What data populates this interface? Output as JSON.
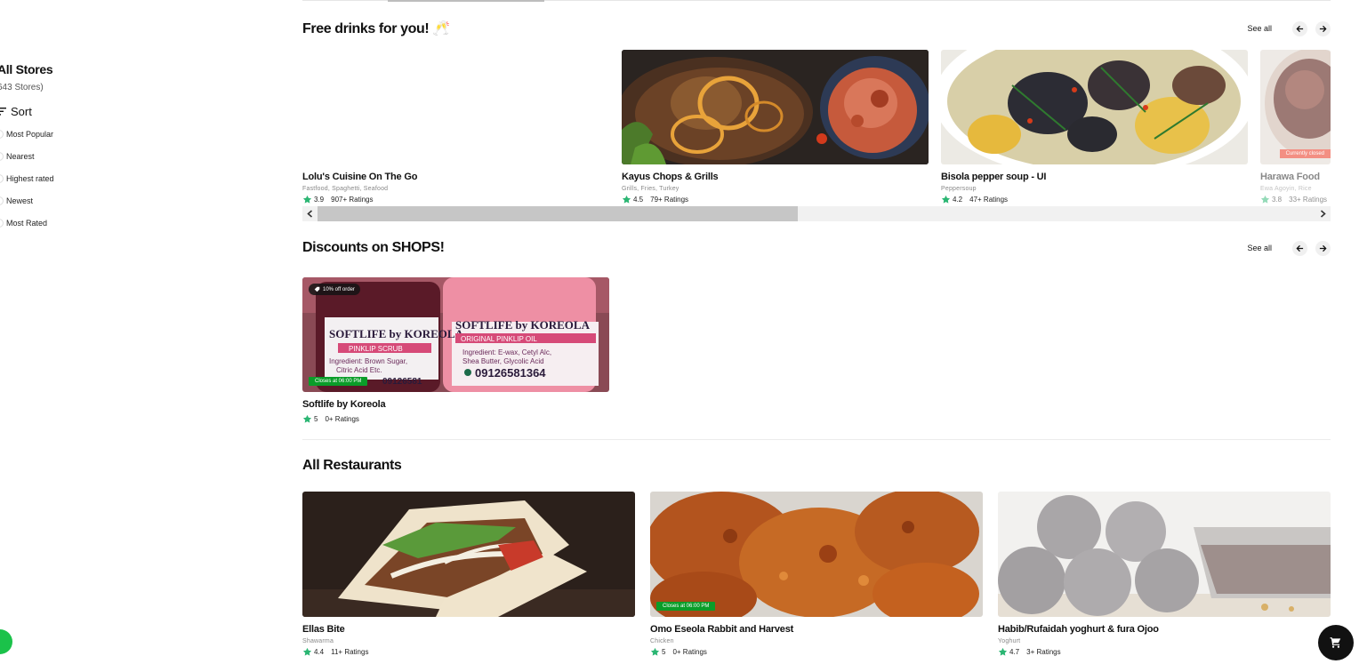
{
  "sidebar": {
    "title": "All Stores",
    "count": "643 Stores)",
    "sort_label": "Sort",
    "sort_options": [
      "Most Popular",
      "Nearest",
      "Highest rated",
      "Newest",
      "Most Rated"
    ]
  },
  "sections": {
    "free_drinks": {
      "title": "Free drinks for you! 🥂",
      "see_all": "See all",
      "cards": [
        {
          "name": "Lolu's Cuisine On The Go",
          "category": "Fastfood, Spaghetti, Seafood",
          "rating": "3.9",
          "ratings_count": "907+ Ratings"
        },
        {
          "name": "Kayus Chops & Grills",
          "category": "Grills, Fries, Turkey",
          "rating": "4.5",
          "ratings_count": "79+ Ratings"
        },
        {
          "name": "Bisola pepper soup - UI",
          "category": "Peppersoup",
          "rating": "4.2",
          "ratings_count": "47+ Ratings"
        },
        {
          "name": "Harawa Food",
          "category": "Ewa Agoyin, Rice",
          "rating": "3.8",
          "ratings_count": "33+ Ratings",
          "badge": "Currently closed"
        }
      ]
    },
    "discounts": {
      "title": "Discounts on SHOPS!",
      "see_all": "See all",
      "cards": [
        {
          "name": "Softlife by Koreola",
          "rating": "5",
          "ratings_count": "0+ Ratings",
          "promo": "10% off order",
          "closes": "Closes at 06:00 PM"
        }
      ]
    },
    "all_restaurants": {
      "title": "All Restaurants",
      "cards": [
        {
          "name": "Ellas Bite",
          "category": "Shawarma",
          "rating": "4.4",
          "ratings_count": "11+ Ratings"
        },
        {
          "name": "Omo Eseola Rabbit and Harvest",
          "category": "Chicken",
          "rating": "5",
          "ratings_count": "0+ Ratings",
          "closes": "Closes at 06:00 PM"
        },
        {
          "name": "Habib/Rufaidah yoghurt & fura Ojoo",
          "category": "Yoghurt",
          "rating": "4.7",
          "ratings_count": "3+ Ratings"
        }
      ]
    }
  },
  "product_image_text": {
    "label_1": "SOFTLIFE by KOREOLA",
    "label_1_sub": "PINKLIP SCRUB",
    "label_1_ingr": "Ingredient: Brown Sugar,",
    "label_1_ingr2": "Citric Acid Etc.",
    "label_1_phone": "09126581",
    "label_2": "SOFTLIFE by KOREOLA",
    "label_2_sub": "ORIGINAL PINKLIP OIL",
    "label_2_ingr": "Ingredient: E-wax, Cetyl Alc,",
    "label_2_ingr2": "Shea Butter, Glycolic Acid",
    "label_2_phone": "09126581364"
  },
  "colors": {
    "accent_green": "#0a9d29",
    "star_green": "#2bb673",
    "closed_red": "#f06a5a"
  },
  "icons": {
    "sort": "sort-icon",
    "arrow_left": "arrow-left-icon",
    "arrow_right": "arrow-right-icon",
    "cart": "cart-icon",
    "star": "star-icon",
    "tag": "tag-icon"
  }
}
